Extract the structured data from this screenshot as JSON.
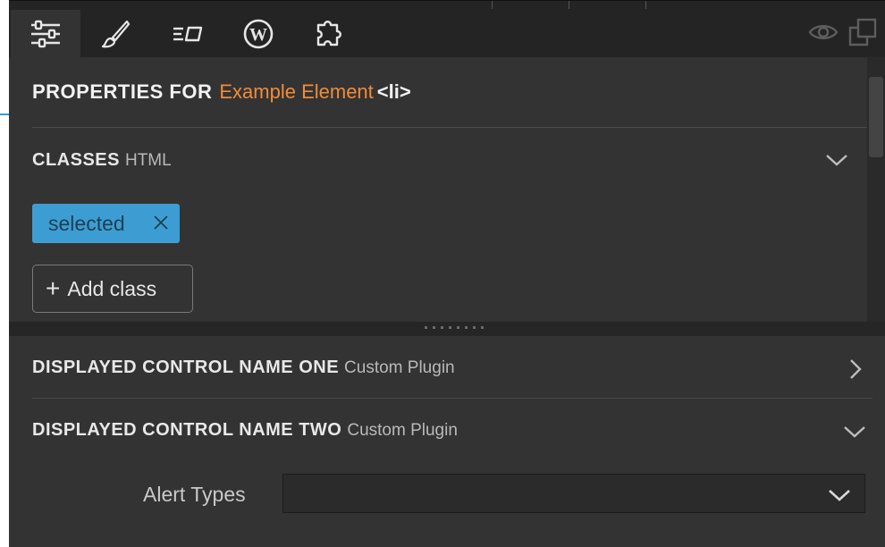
{
  "toolbar": {
    "tabs": [
      {
        "icon": "sliders-icon",
        "active": true
      },
      {
        "icon": "brush-icon",
        "active": false
      },
      {
        "icon": "text-box-icon",
        "active": false
      },
      {
        "icon": "wordpress-icon",
        "active": false
      },
      {
        "icon": "puzzle-icon",
        "active": false
      }
    ],
    "right_icons": [
      "eye-icon",
      "duplicate-icon"
    ]
  },
  "properties": {
    "label": "PROPERTIES FOR",
    "element_name": "Example Element",
    "element_tag": "<li>"
  },
  "classes": {
    "title": "CLASSES",
    "subtitle": "HTML",
    "tags": [
      {
        "label": "selected"
      }
    ],
    "add_label": "Add class"
  },
  "controls": [
    {
      "title": "DISPLAYED CONTROL NAME ONE",
      "subtitle": "Custom Plugin",
      "expanded": false
    },
    {
      "title": "DISPLAYED CONTROL NAME TWO",
      "subtitle": "Custom Plugin",
      "expanded": true
    }
  ],
  "alert_types": {
    "label": "Alert Types",
    "value": ""
  },
  "colors": {
    "accent_orange": "#f08c3a",
    "tag_blue": "#3d9dd3",
    "panel_bg": "#333333",
    "toolbar_bg": "#242424"
  }
}
